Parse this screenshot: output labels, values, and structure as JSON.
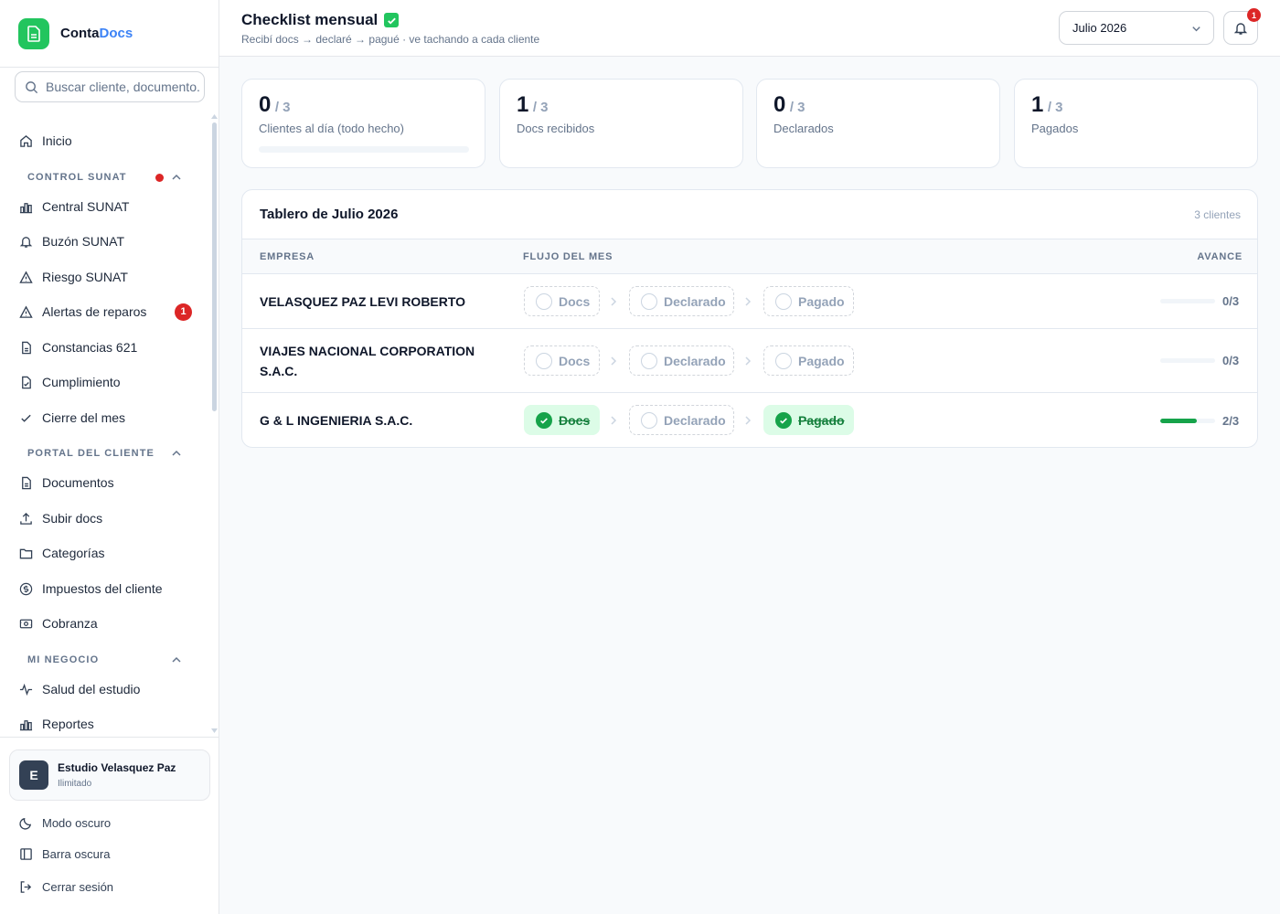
{
  "brand": {
    "name_primary": "Conta",
    "name_accent": "Docs"
  },
  "search": {
    "placeholder": "Buscar cliente, documento..."
  },
  "nav": {
    "inicio": "Inicio",
    "section_control": "CONTROL SUNAT",
    "central_sunat": "Central SUNAT",
    "buzon_sunat": "Buzón SUNAT",
    "riesgo_sunat": "Riesgo SUNAT",
    "alertas_reparos": "Alertas de reparos",
    "alertas_badge": "1",
    "constancias": "Constancias 621",
    "cumplimiento": "Cumplimiento",
    "cierre_mes": "Cierre del mes",
    "section_portal": "PORTAL DEL CLIENTE",
    "documentos": "Documentos",
    "subir_docs": "Subir docs",
    "categorias": "Categorías",
    "impuestos_cliente": "Impuestos del cliente",
    "cobranza": "Cobranza",
    "section_negocio": "MI NEGOCIO",
    "salud_estudio": "Salud del estudio",
    "reportes": "Reportes"
  },
  "user": {
    "initial": "E",
    "name": "Estudio Velasquez Paz",
    "plan": "Ilimitado"
  },
  "bottom": {
    "modo_oscuro": "Modo oscuro",
    "barra_oscura": "Barra oscura",
    "cerrar_sesion": "Cerrar sesión"
  },
  "header": {
    "title": "Checklist mensual",
    "subtitle": "Recibí docs → declaré → pagué · ve tachando a cada cliente",
    "month": "Julio 2026",
    "notif_count": "1"
  },
  "stats": [
    {
      "value": "0",
      "total": "/ 3",
      "label": "Clientes al día (todo hecho)",
      "progress": 0
    },
    {
      "value": "1",
      "total": "/ 3",
      "label": "Docs recibidos"
    },
    {
      "value": "0",
      "total": "/ 3",
      "label": "Declarados"
    },
    {
      "value": "1",
      "total": "/ 3",
      "label": "Pagados"
    }
  ],
  "board": {
    "title": "Tablero de Julio 2026",
    "count": "3 clientes",
    "columns": {
      "empresa": "EMPRESA",
      "flujo": "FLUJO DEL MES",
      "avance": "AVANCE"
    },
    "rows": [
      {
        "company": "VELASQUEZ PAZ LEVI ROBERTO",
        "docs": "Docs",
        "declarado": "Declarado",
        "pagado": "Pagado",
        "docs_done": false,
        "declarado_done": false,
        "pagado_done": false,
        "progress": 0,
        "progress_text": "0/3"
      },
      {
        "company": "VIAJES NACIONAL CORPORATION S.A.C.",
        "docs": "Docs",
        "declarado": "Declarado",
        "pagado": "Pagado",
        "docs_done": false,
        "declarado_done": false,
        "pagado_done": false,
        "progress": 0,
        "progress_text": "0/3"
      },
      {
        "company": "G & L INGENIERIA S.A.C.",
        "docs": "Docs",
        "declarado": "Declarado",
        "pagado": "Pagado",
        "docs_done": true,
        "declarado_done": false,
        "pagado_done": true,
        "progress": 0.667,
        "progress_text": "2/3"
      }
    ]
  },
  "colors": {
    "accent_green": "#16a34a",
    "brand_blue": "#3b82f6",
    "alert_red": "#dc2626"
  }
}
